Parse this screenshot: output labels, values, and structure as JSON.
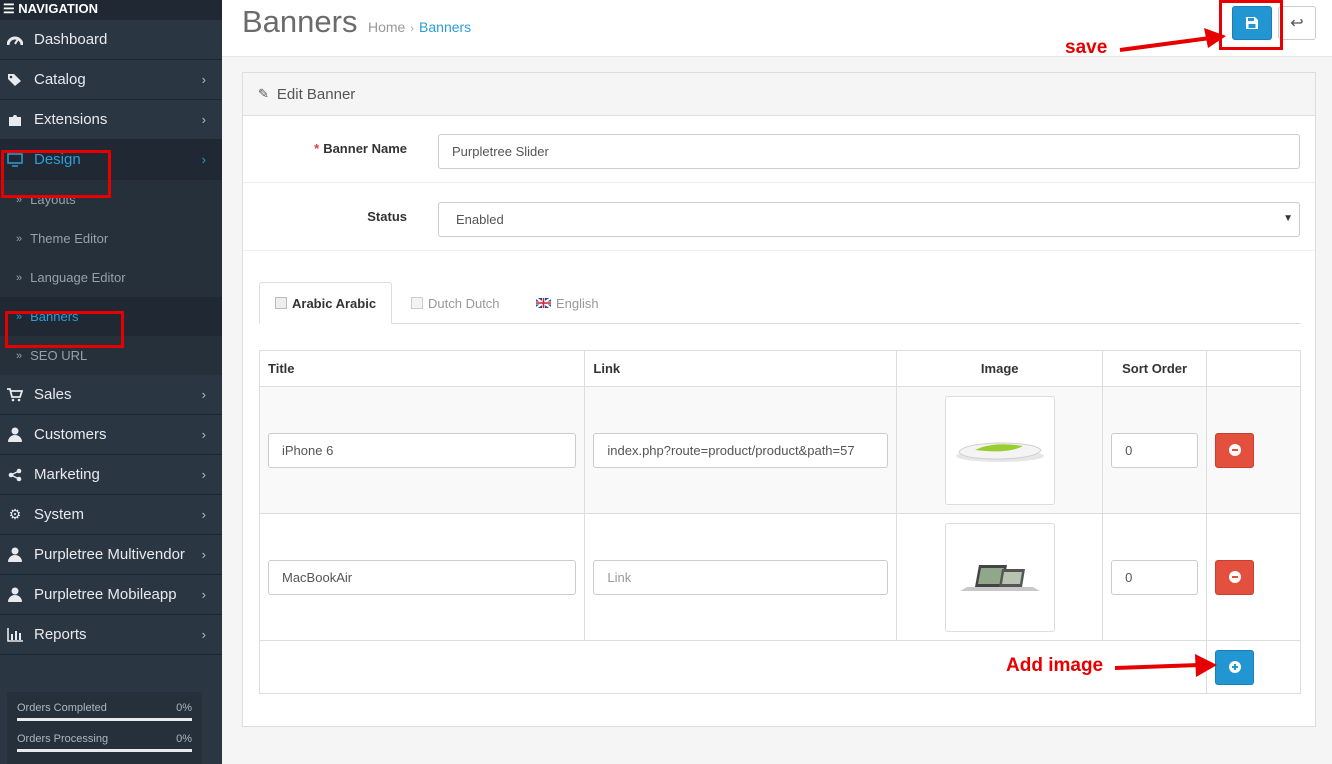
{
  "sidebar": {
    "header": "NAVIGATION",
    "menu": [
      {
        "label": "Dashboard",
        "icon": "dashboard-icon"
      },
      {
        "label": "Catalog",
        "icon": "tags-icon"
      },
      {
        "label": "Extensions",
        "icon": "puzzle-icon"
      },
      {
        "label": "Design",
        "icon": "monitor-icon"
      },
      {
        "label": "Sales",
        "icon": "cart-icon"
      },
      {
        "label": "Customers",
        "icon": "user-icon"
      },
      {
        "label": "Marketing",
        "icon": "share-icon"
      },
      {
        "label": "System",
        "icon": "gear-icon"
      },
      {
        "label": "Purpletree Multivendor",
        "icon": "user-icon"
      },
      {
        "label": "Purpletree Mobileapp",
        "icon": "user-icon"
      },
      {
        "label": "Reports",
        "icon": "bar-chart-icon"
      }
    ],
    "design_submenu": [
      "Layouts",
      "Theme Editor",
      "Language Editor",
      "Banners",
      "SEO URL"
    ],
    "progress": [
      {
        "label": "Orders Completed",
        "value": "0%"
      },
      {
        "label": "Orders Processing",
        "value": "0%"
      }
    ]
  },
  "header": {
    "title": "Banners",
    "breadcrumb": [
      "Home",
      "Banners"
    ]
  },
  "panel": {
    "heading": "Edit Banner",
    "banner_name_label": "Banner Name",
    "banner_name_value": "Purpletree Slider",
    "status_label": "Status",
    "status_value": "Enabled",
    "tabs": [
      {
        "label": "Arabic Arabic"
      },
      {
        "label": "Dutch Dutch"
      },
      {
        "label": "English"
      }
    ],
    "table": {
      "columns": [
        "Title",
        "Link",
        "Image",
        "Sort Order"
      ],
      "rows": [
        {
          "title": "iPhone 6",
          "link": "index.php?route=product/product&path=57",
          "sort": "0"
        },
        {
          "title": "MacBookAir",
          "link": "",
          "link_placeholder": "Link",
          "sort": "0"
        }
      ]
    }
  },
  "annotations": {
    "save": "save",
    "add_image": "Add image"
  },
  "colors": {
    "sidebar_bg": "#2b3643",
    "accent": "#2c9ed8",
    "danger": "#e3503e",
    "annotation": "#e60000"
  }
}
